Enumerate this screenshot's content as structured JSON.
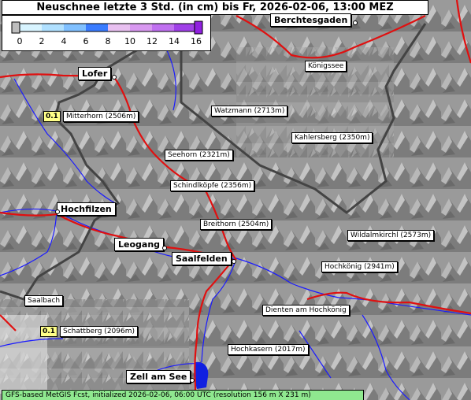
{
  "title": "Neuschnee letzte 3 Std. (in cm) bis Fr, 2026-02-06, 13:00 MEZ",
  "legend": {
    "ticks": [
      "0",
      "2",
      "4",
      "6",
      "8",
      "10",
      "12",
      "14",
      "16"
    ],
    "colors": [
      "#bdbdbd",
      "#d8f4ff",
      "#b0e0ff",
      "#80c0ff",
      "#4f8fff",
      "#e0b0f0",
      "#d090f0",
      "#b060f0",
      "#9020e0"
    ]
  },
  "peaks": [
    {
      "name": "Mitterhorn (2506m)"
    },
    {
      "name": "Watzmann (2713m)"
    },
    {
      "name": "Kahlersberg (2350m)"
    },
    {
      "name": "Seehorn (2321m)"
    },
    {
      "name": "Schindlköpfe (2356m)"
    },
    {
      "name": "Breithorn (2504m)"
    },
    {
      "name": "Wildalmkirchl (2573m)"
    },
    {
      "name": "Hochkönig (2941m)"
    },
    {
      "name": "Dienten am Hochkönig"
    },
    {
      "name": "Königssee"
    },
    {
      "name": "Saalbach"
    },
    {
      "name": "Schattberg (2096m)"
    },
    {
      "name": "Hochkasern (2017m)"
    }
  ],
  "towns": [
    {
      "name": "Berchtesgaden"
    },
    {
      "name": "Lofer"
    },
    {
      "name": "Hochfilzen"
    },
    {
      "name": "Leogang"
    },
    {
      "name": "Saalfelden"
    },
    {
      "name": "Zell am See"
    }
  ],
  "values": [
    "0.1",
    "0.1"
  ],
  "footer": "GFS-based MetGIS Fcst, initialized 2026-02-06, 06:00 UTC  (resolution 156 m X 231 m)"
}
